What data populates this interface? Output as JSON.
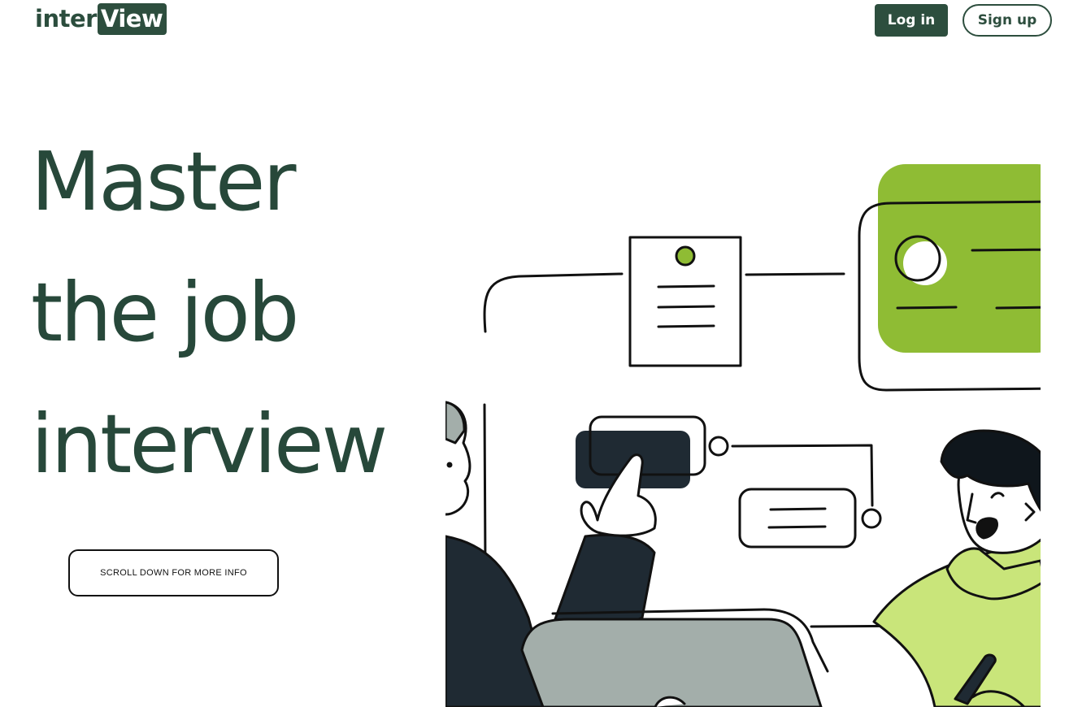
{
  "header": {
    "logo": {
      "prefix": "inter",
      "highlight": "View"
    },
    "login_label": "Log in",
    "signup_label": "Sign up"
  },
  "hero": {
    "title_lines": [
      "Master",
      "the job",
      "interview"
    ],
    "scroll_label": "SCROLL DOWN FOR MORE INFO"
  },
  "colors": {
    "brand_dark": "#2d4e3e",
    "accent_green": "#8fbc34",
    "light_green": "#c9e57a",
    "ink": "#1f2a33",
    "laptop_gray": "#a3aeaa"
  },
  "illustration": {
    "name": "job-interview-illustration"
  }
}
